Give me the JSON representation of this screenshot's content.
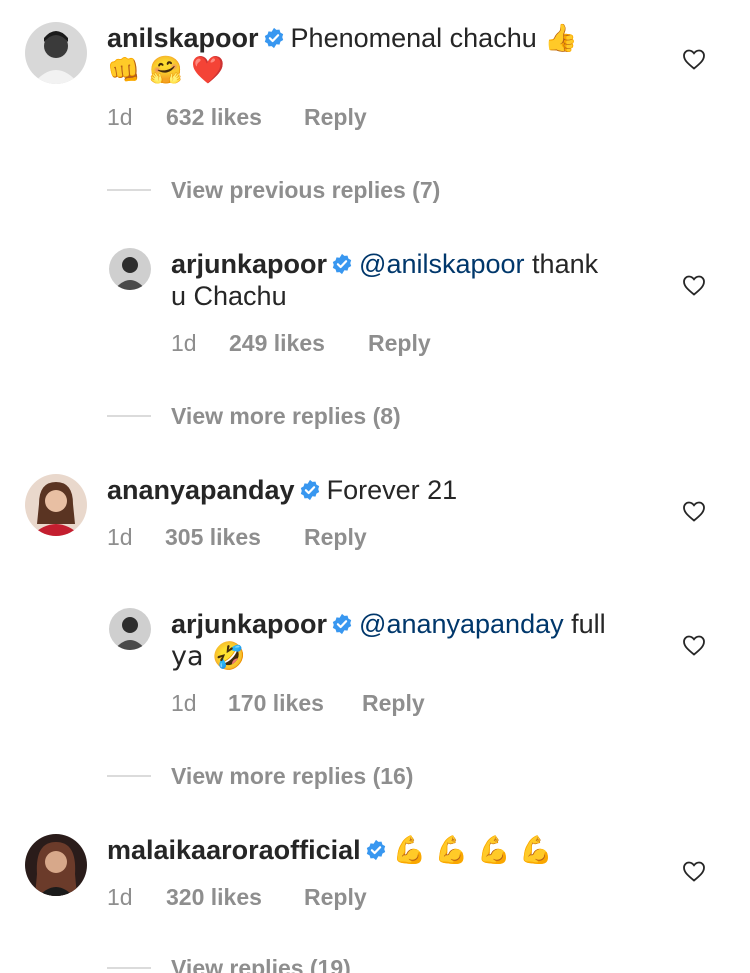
{
  "comments": [
    {
      "username": "anilskapoor",
      "text": "Phenomenal chachu 👍",
      "text2": "👊 🤗 ❤️",
      "time": "1d",
      "likes": "632 likes",
      "reply": "Reply",
      "view_replies": "View previous replies (7)"
    },
    {
      "username": "arjunkapoor",
      "mention": "@anilskapoor",
      "text": "thank",
      "text2": "u Chachu",
      "time": "1d",
      "likes": "249 likes",
      "reply": "Reply",
      "view_replies": "View more replies (8)"
    },
    {
      "username": "ananyapanday",
      "text": "Forever 21",
      "time": "1d",
      "likes": "305 likes",
      "reply": "Reply"
    },
    {
      "username": "arjunkapoor",
      "mention": "@ananyapanday",
      "text": "full",
      "text2": "ya 🤣",
      "time": "1d",
      "likes": "170 likes",
      "reply": "Reply",
      "view_replies": "View more replies (16)"
    },
    {
      "username": "malaikaaroraofficial",
      "text": "💪 💪 💪 💪",
      "time": "1d",
      "likes": "320 likes",
      "reply": "Reply",
      "view_replies": "View replies (19)"
    }
  ],
  "colors": {
    "text": "#262626",
    "secondary": "#8e8e8e",
    "mention": "#00376b",
    "verified": "#3897f0",
    "divider": "#dbdbdb"
  },
  "icons": {
    "verified": "verified-badge-icon",
    "like": "heart-outline-icon"
  }
}
